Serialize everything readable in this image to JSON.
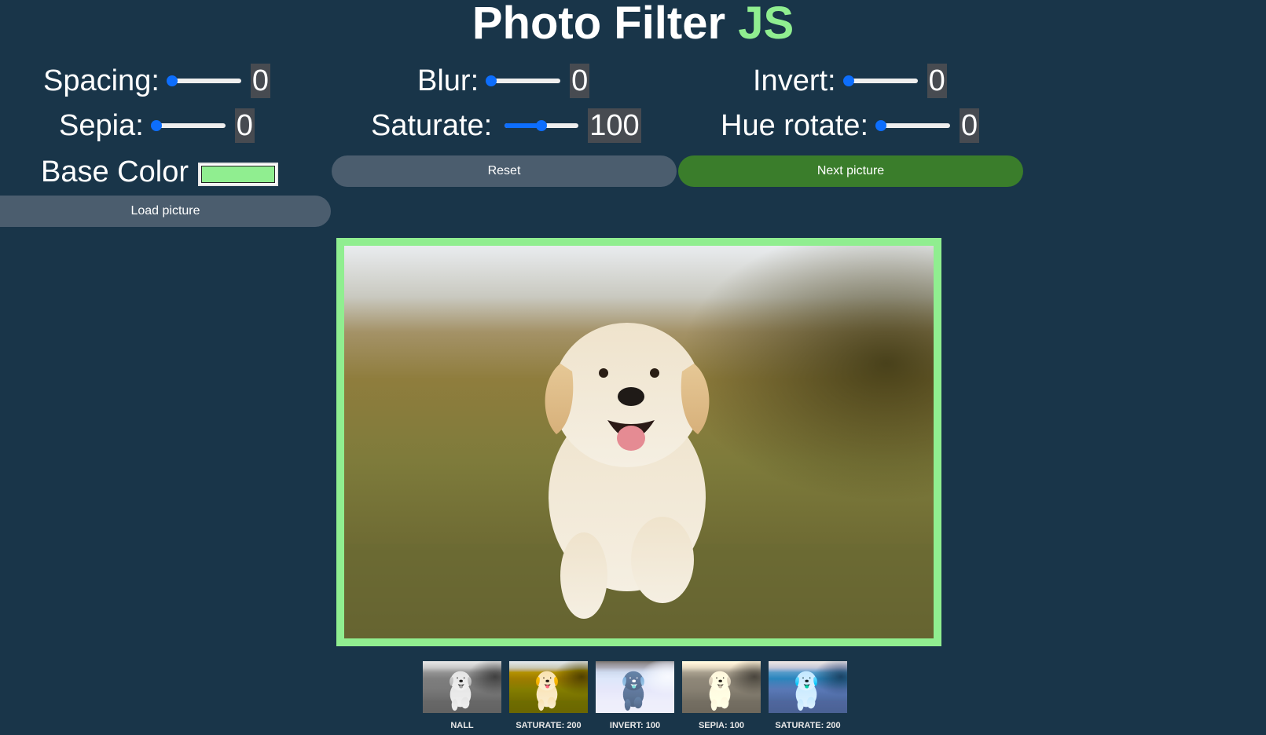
{
  "header": {
    "title_main": "Photo Filter",
    "title_accent": "JS",
    "accent_color": "#90ee90"
  },
  "controls": {
    "spacing": {
      "label": "Spacing:",
      "value": "0",
      "fraction": 0
    },
    "blur": {
      "label": "Blur:",
      "value": "0",
      "fraction": 0
    },
    "invert": {
      "label": "Invert:",
      "value": "0",
      "fraction": 0
    },
    "sepia": {
      "label": "Sepia:",
      "value": "0",
      "fraction": 0
    },
    "saturate": {
      "label": "Saturate:",
      "value": "100",
      "fraction": 0.5
    },
    "hue_rotate": {
      "label": "Hue rotate:",
      "value": "0",
      "fraction": 0
    },
    "base_color": {
      "label": "Base Color",
      "value": "#90ee90"
    }
  },
  "buttons": {
    "reset": "Reset",
    "next": "Next picture",
    "load": "Load picture"
  },
  "colors": {
    "background": "#193549",
    "button_gray": "#4b5d6e",
    "button_green": "#3a7d2b",
    "slider_blue": "#0d6efd"
  },
  "main_image": {
    "subject": "puppy-running-on-grass"
  },
  "thumbnails": [
    {
      "label": "NALL",
      "filter": "grayscale"
    },
    {
      "label": "SATURATE: 200",
      "filter": "saturate"
    },
    {
      "label": "INVERT: 100",
      "filter": "invert"
    },
    {
      "label": "SEPIA: 100",
      "filter": "sepia"
    },
    {
      "label": "SATURATE: 200",
      "filter": "blue-tint"
    }
  ]
}
